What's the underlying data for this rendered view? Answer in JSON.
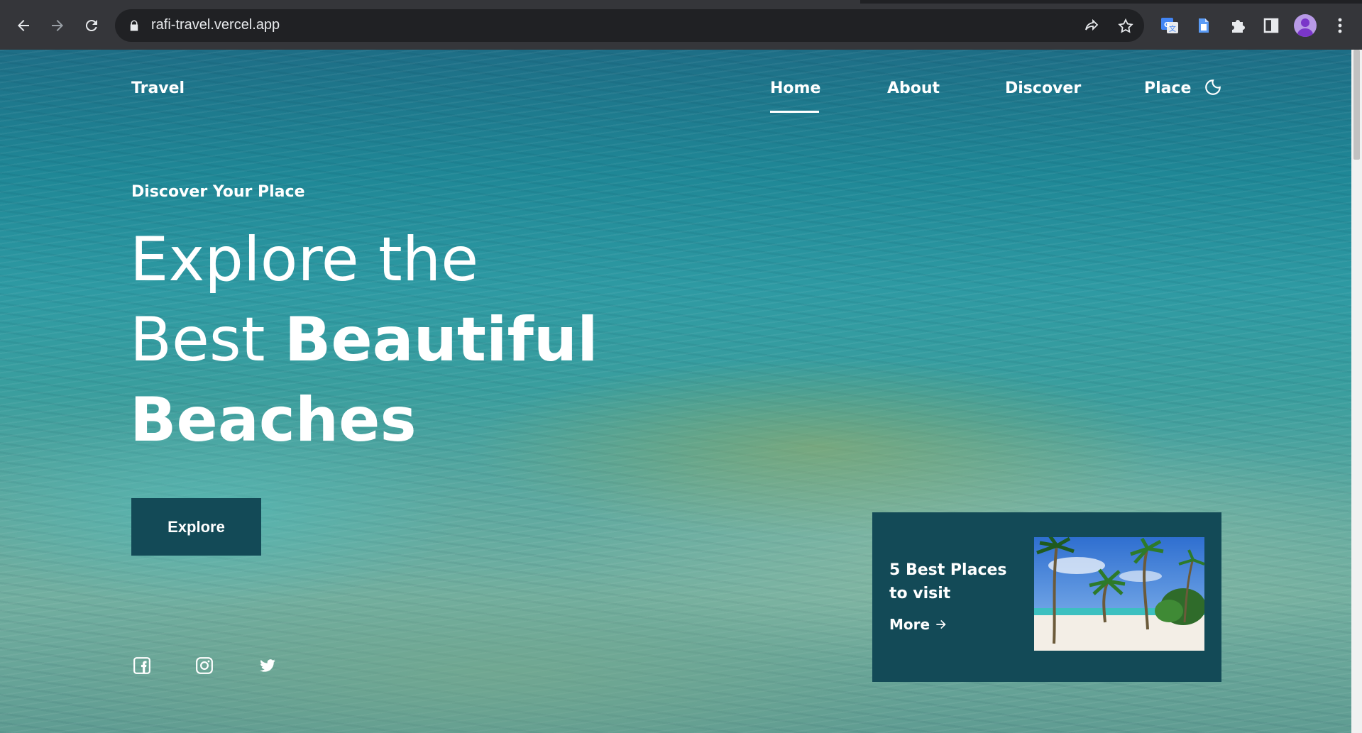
{
  "browser": {
    "url": "rafi-travel.vercel.app",
    "icons": [
      "back-icon",
      "forward-icon",
      "reload-icon",
      "lock-icon",
      "share-icon",
      "star-icon",
      "google-translate-icon",
      "extension-icon",
      "puzzle-icon",
      "side-panel-icon",
      "profile-avatar",
      "more-menu-icon"
    ]
  },
  "header": {
    "brand": "Travel",
    "nav": [
      {
        "label": "Home",
        "active": true
      },
      {
        "label": "About",
        "active": false
      },
      {
        "label": "Discover",
        "active": false
      },
      {
        "label": "Place",
        "active": false
      }
    ],
    "theme_toggle_icon": "moon-icon"
  },
  "hero": {
    "eyebrow": "Discover Your Place",
    "line1": "Explore the",
    "line2_light": "Best ",
    "line2_bold": "Beautiful",
    "line3": "Beaches",
    "cta": "Explore"
  },
  "social": [
    "facebook-icon",
    "instagram-icon",
    "twitter-icon"
  ],
  "card": {
    "title": "5 Best Places to visit",
    "more": "More",
    "more_icon": "arrow-right-icon",
    "image": "palm-beach-thumbnail"
  },
  "colors": {
    "accent": "#134a57",
    "text": "#ffffff",
    "chrome": "#35363a",
    "omnibox": "#202124"
  }
}
